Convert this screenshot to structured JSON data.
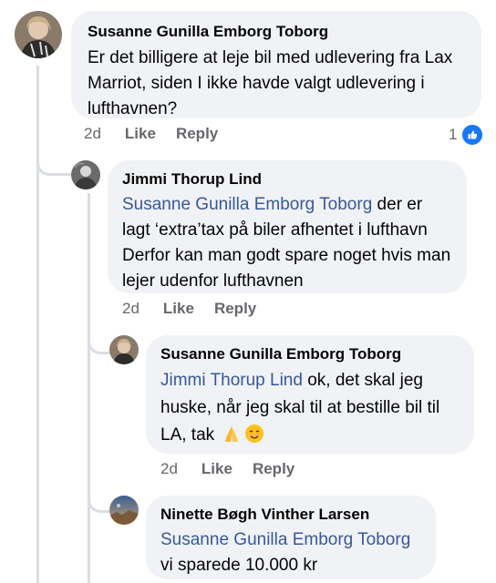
{
  "comments": [
    {
      "author": "Susanne Gunilla Emborg Toborg",
      "text": "Er det billigere at leje bil med udlevering fra Lax Marriot, siden I ikke havde valgt udlevering i lufthavnen?",
      "time": "2d",
      "like_label": "Like",
      "reply_label": "Reply",
      "reaction_count": "1",
      "reaction_icon": "thumbs-up-icon"
    },
    {
      "author": "Jimmi Thorup Lind",
      "mention": "Susanne Gunilla Emborg Toborg",
      "text_line1": " der er",
      "text_rest": "lagt ‘extra’tax på biler afhentet i lufthavn Derfor kan man godt spare noget hvis man lejer udenfor lufthavnen",
      "time": "2d",
      "like_label": "Like",
      "reply_label": "Reply"
    },
    {
      "author": "Susanne Gunilla Emborg Toborg",
      "mention": "Jimmi Thorup Lind",
      "text": " ok, det skal jeg huske, når jeg skal til at bestille bil til LA, tak",
      "emojis": [
        "folded-hands-icon",
        "smiling-face-icon"
      ],
      "time": "2d",
      "like_label": "Like",
      "reply_label": "Reply"
    },
    {
      "author": "Ninette Bøgh Vinther Larsen",
      "mention": "Susanne Gunilla Emborg Toborg",
      "text": "vi sparede 10.000 kr"
    }
  ],
  "colors": {
    "bubble": "#f0f2f5",
    "mention": "#385898",
    "meta": "#65676b",
    "like_blue": "#1877f2"
  }
}
